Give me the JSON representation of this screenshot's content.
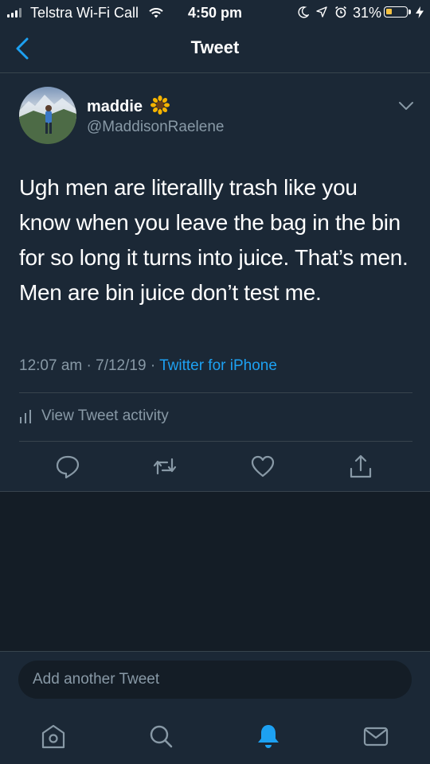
{
  "status_bar": {
    "carrier": "Telstra Wi-Fi Call",
    "time": "4:50 pm",
    "battery": "31%",
    "battery_level": 0.31
  },
  "header": {
    "title": "Tweet",
    "back_icon": "back-chevron-icon"
  },
  "tweet": {
    "author_name": "maddie",
    "author_emoji": "🌻",
    "handle": "@MaddisonRaelene",
    "text": "Ugh men are literallly trash like you know when you leave the bag in the bin for so long it turns into juice. That’s men. Men are bin juice don’t test me.",
    "time": "12:07 am",
    "date": "7/12/19",
    "source": "Twitter for iPhone",
    "activity_label": "View Tweet activity",
    "actions": [
      "reply-icon",
      "retweet-icon",
      "like-icon",
      "share-icon"
    ]
  },
  "composer": {
    "placeholder": "Add another Tweet"
  },
  "tab_bar": [
    "home-icon",
    "search-icon",
    "notifications-icon",
    "messages-icon"
  ],
  "colors": {
    "background": "#141d26",
    "surface": "#1b2836",
    "accent": "#1da1f2",
    "muted": "#8899a6",
    "border": "#38444d"
  }
}
